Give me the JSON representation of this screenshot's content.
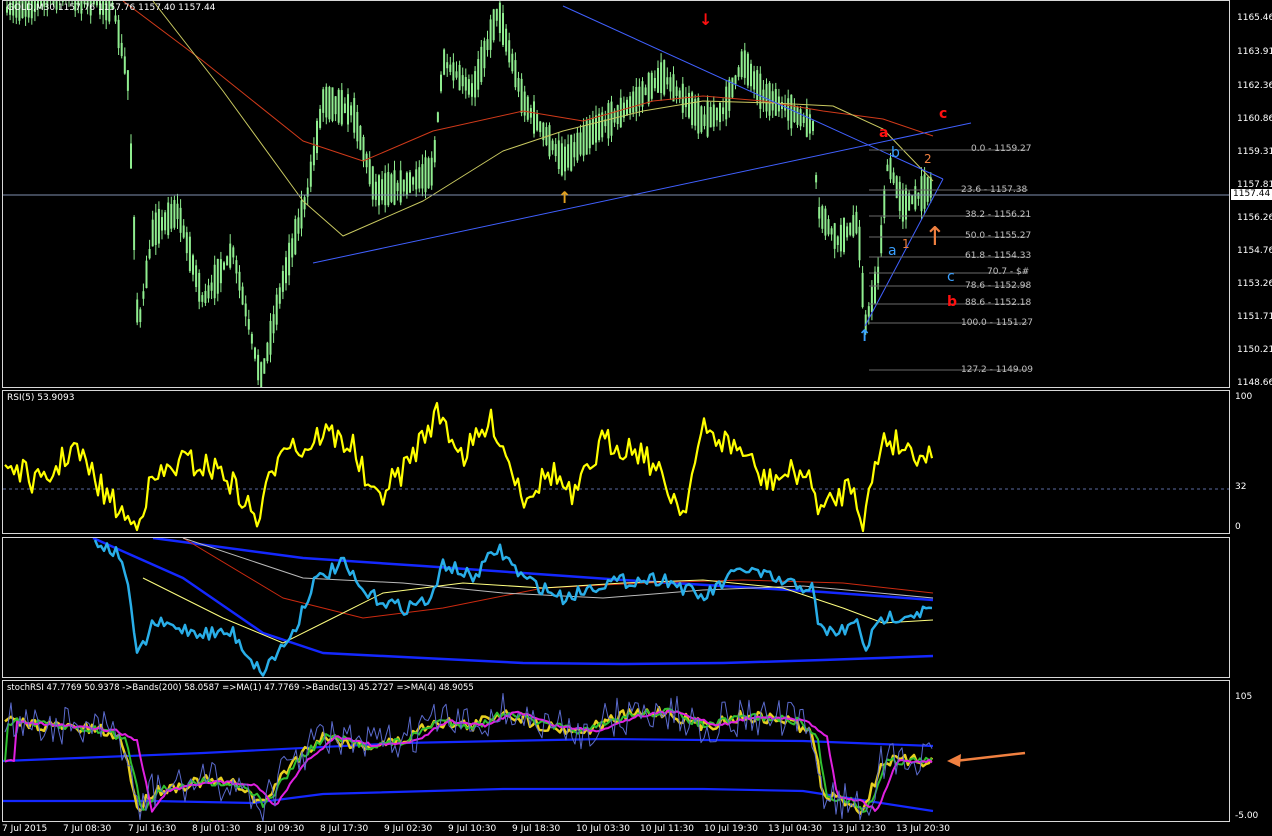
{
  "main": {
    "title": "GOLD,M30  1157.76 1157.76 1157.40 1157.44",
    "current_price": "1157.44",
    "price_scale": [
      "1165.46",
      "1163.91",
      "1162.36",
      "1160.86",
      "1159.31",
      "1157.81",
      "1156.26",
      "1154.76",
      "1153.26",
      "1151.71",
      "1150.21",
      "1148.66"
    ],
    "fib_levels": [
      "0.0 - 1159.27",
      "23.6 - 1157.38",
      "38.2 - 1156.21",
      "50.0 - 1155.27",
      "61.8 - 1154.33",
      "70.7 - $#",
      "78.6 - 1152.98",
      "88.6 - 1152.18",
      "100.0 - 1151.27",
      "127.2 - 1149.09"
    ],
    "wave_labels": {
      "red_a": "a",
      "red_b": "b",
      "red_c": "c",
      "blue_a": "a",
      "blue_b": "b",
      "blue_c": "c",
      "orange_1": "1",
      "orange_2": "2"
    },
    "colors": {
      "candles": "#90ee90",
      "ma_red": "#d03a1a",
      "ma_yellow": "#c8c860",
      "trendline": "#4060ff",
      "red": "#ff1010",
      "blue": "#3aa0ff",
      "orange": "#f08040"
    }
  },
  "rsi": {
    "title": "RSI(5) 53.9093",
    "scale_top": "100",
    "scale_mid": "32",
    "scale_bottom": "0",
    "color": "#ffff00"
  },
  "ind2": {
    "color": "#29aee8"
  },
  "stoch": {
    "title": "stochRSI 47.7769 50.9378 ->Bands(200) 58.0587 =>MA(1) 47.7769 ->Bands(13) 45.2727 =>MA(4) 48.9055",
    "scale_top": "105",
    "scale_bottom": "-5.00"
  },
  "time_axis": [
    "7 Jul 2015",
    "7 Jul 08:30",
    "7 Jul 16:30",
    "8 Jul 01:30",
    "8 Jul 09:30",
    "8 Jul 17:30",
    "9 Jul 02:30",
    "9 Jul 10:30",
    "9 Jul 18:30",
    "10 Jul 03:30",
    "10 Jul 11:30",
    "10 Jul 19:30",
    "13 Jul 04:30",
    "13 Jul 12:30",
    "13 Jul 20:30"
  ]
}
